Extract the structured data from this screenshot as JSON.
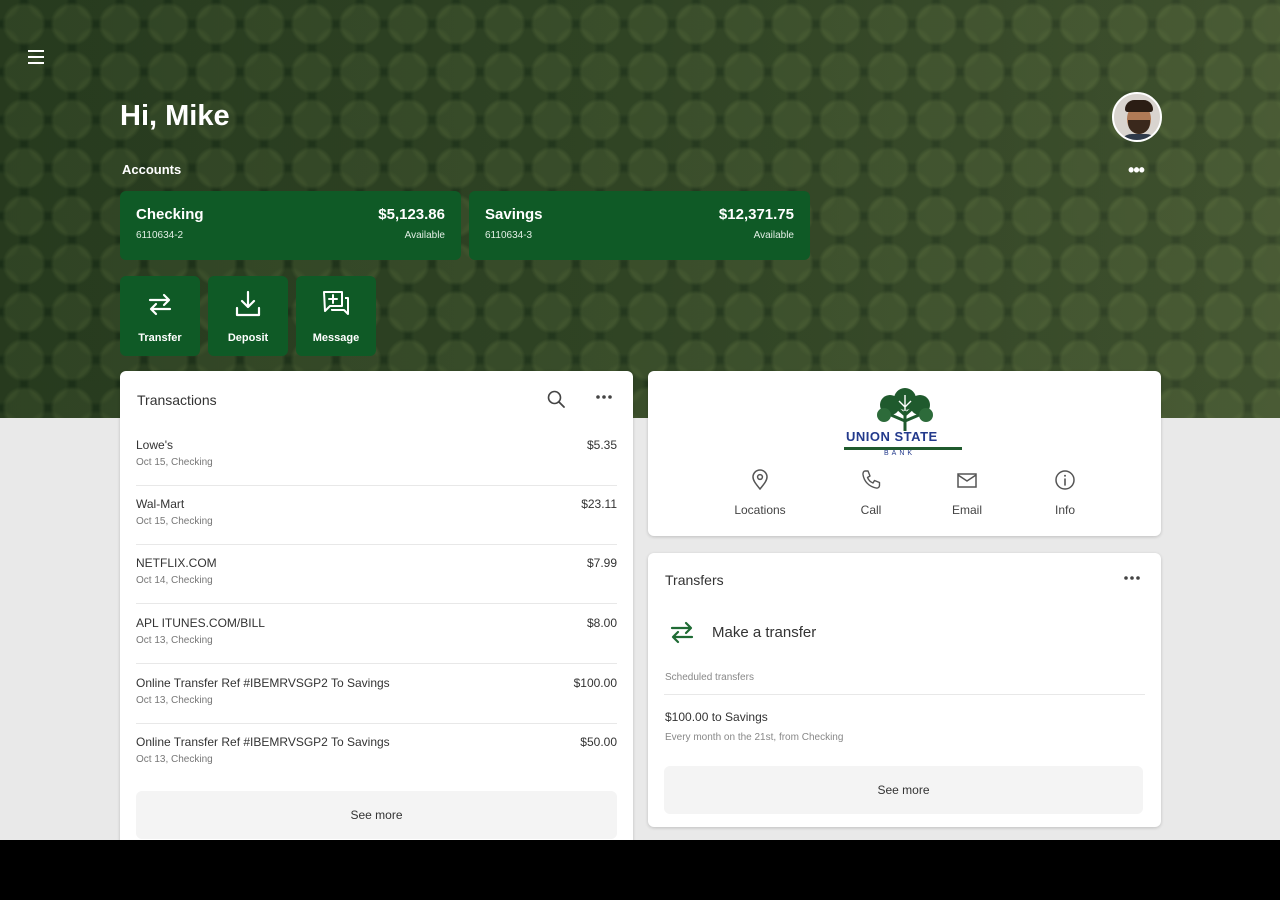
{
  "colors": {
    "brand_green": "#0f5a26",
    "icon_green": "#1f6b34",
    "bank_blue": "#233a8c"
  },
  "header": {
    "menu_icon": "hamburger-icon",
    "greeting": "Hi, Mike",
    "accounts_label": "Accounts",
    "more_icon": "more-horizontal-icon"
  },
  "accounts": [
    {
      "name": "Checking",
      "number": "6110634-2",
      "balance": "$5,123.86",
      "status": "Available"
    },
    {
      "name": "Savings",
      "number": "6110634-3",
      "balance": "$12,371.75",
      "status": "Available"
    }
  ],
  "actions": [
    {
      "label": "Transfer",
      "icon": "transfer-arrows-icon"
    },
    {
      "label": "Deposit",
      "icon": "download-tray-icon"
    },
    {
      "label": "Message",
      "icon": "chat-plus-icon"
    }
  ],
  "transactions": {
    "title": "Transactions",
    "items": [
      {
        "merchant": "Lowe's",
        "detail": "Oct 15, Checking",
        "amount": "$5.35"
      },
      {
        "merchant": "Wal-Mart",
        "detail": "Oct 15, Checking",
        "amount": "$23.11"
      },
      {
        "merchant": "NETFLIX.COM",
        "detail": "Oct 14, Checking",
        "amount": "$7.99"
      },
      {
        "merchant": "APL ITUNES.COM/BILL",
        "detail": "Oct 13, Checking",
        "amount": "$8.00"
      },
      {
        "merchant": "Online Transfer Ref #IBEMRVSGP2 To Savings",
        "detail": "Oct 13, Checking",
        "amount": "$100.00"
      },
      {
        "merchant": "Online Transfer Ref #IBEMRVSGP2 To Savings",
        "detail": "Oct 13, Checking",
        "amount": "$50.00"
      }
    ],
    "see_more": "See more"
  },
  "bank": {
    "logo_text": "UNION STATE",
    "logo_tagline": "BANK",
    "links": [
      {
        "label": "Locations",
        "icon": "location-pin-icon"
      },
      {
        "label": "Call",
        "icon": "phone-icon"
      },
      {
        "label": "Email",
        "icon": "email-icon"
      },
      {
        "label": "Info",
        "icon": "info-icon"
      }
    ]
  },
  "transfers": {
    "title": "Transfers",
    "make_transfer": "Make a transfer",
    "scheduled_label": "Scheduled transfers",
    "scheduled": [
      {
        "title": "$100.00 to Savings",
        "subtitle": "Every month on the 21st, from Checking"
      }
    ],
    "see_more": "See more"
  }
}
